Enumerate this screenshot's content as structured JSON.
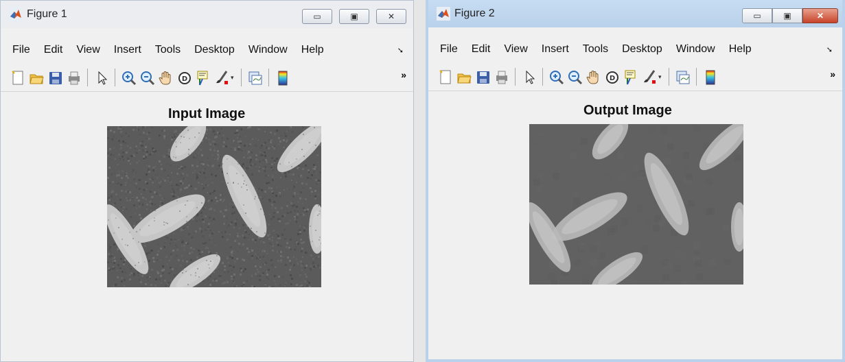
{
  "windows": [
    {
      "title": "Figure 1",
      "menu": [
        "File",
        "Edit",
        "View",
        "Insert",
        "Tools",
        "Desktop",
        "Window",
        "Help"
      ],
      "axes_title": "Input Image",
      "image_style": "noisy"
    },
    {
      "title": "Figure 2",
      "menu": [
        "File",
        "Edit",
        "View",
        "Insert",
        "Tools",
        "Desktop",
        "Window",
        "Help"
      ],
      "axes_title": "Output Image",
      "image_style": "smoothed"
    }
  ],
  "toolbar_icons": [
    "new-figure-icon",
    "open-file-icon",
    "save-icon",
    "print-icon",
    "pointer-icon",
    "zoom-in-icon",
    "zoom-out-icon",
    "pan-hand-icon",
    "rotate-3d-icon",
    "data-cursor-icon",
    "brush-icon",
    "link-plot-icon",
    "colorbar-icon"
  ],
  "colors": {
    "window_bg": "#f0f0f0",
    "active_title": "#b9d1ea",
    "close_active": "#c7432a",
    "image_bg": "#5d5d5d",
    "grain": "#c9c9c9"
  }
}
